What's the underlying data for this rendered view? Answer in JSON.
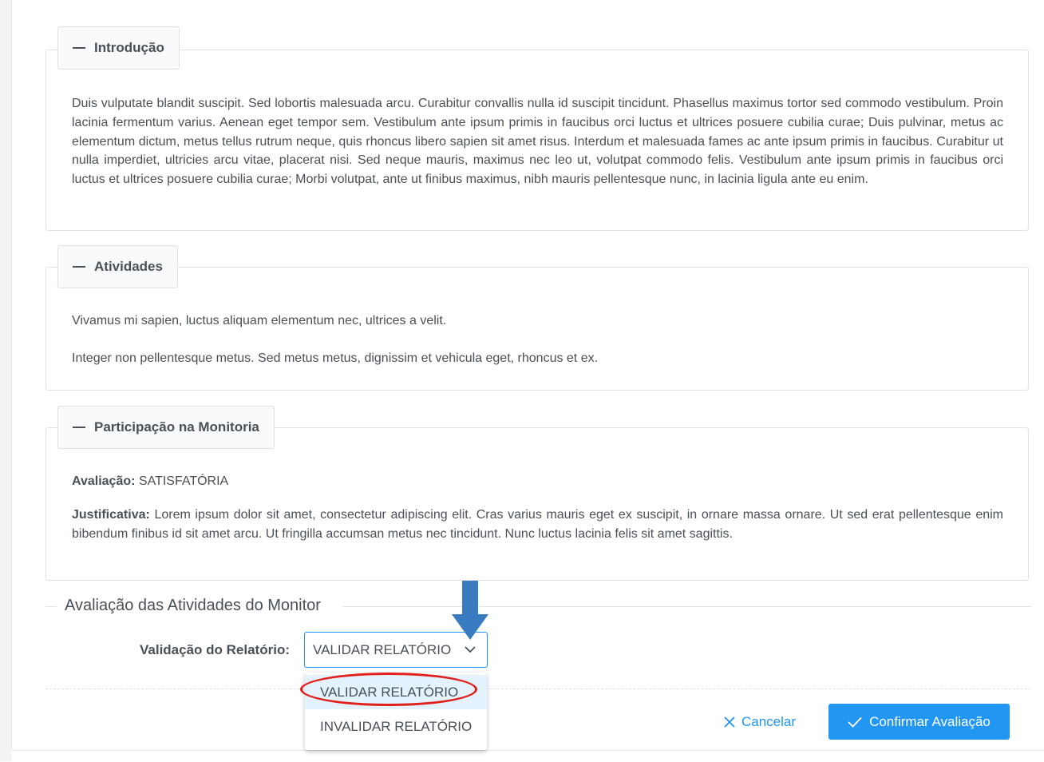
{
  "sections": {
    "introducao": {
      "legend": "Introdução",
      "text": "Duis vulputate blandit suscipit. Sed lobortis malesuada arcu. Curabitur convallis nulla id suscipit tincidunt. Phasellus maximus tortor sed commodo vestibulum. Proin lacinia fermentum varius. Aenean eget tempor sem. Vestibulum ante ipsum primis in faucibus orci luctus et ultrices posuere cubilia curae; Duis pulvinar, metus ac elementum dictum, metus tellus rutrum neque, quis rhoncus libero sapien sit amet risus. Interdum et malesuada fames ac ante ipsum primis in faucibus. Curabitur ut nulla imperdiet, ultricies arcu vitae, placerat nisi. Sed neque mauris, maximus nec leo ut, volutpat commodo felis. Vestibulum ante ipsum primis in faucibus orci luctus et ultrices posuere cubilia curae; Morbi volutpat, ante ut finibus maximus, nibh mauris pellentesque nunc, in lacinia ligula ante eu enim."
    },
    "atividades": {
      "legend": "Atividades",
      "paragraphs": [
        "Vivamus mi sapien, luctus aliquam elementum nec, ultrices a velit.",
        "Integer non pellentesque metus. Sed metus metus, dignissim et vehicula eget, rhoncus et ex."
      ]
    },
    "participacao": {
      "legend": "Participação na Monitoria",
      "avaliacao_label": "Avaliação:",
      "avaliacao_value": "SATISFATÓRIA",
      "justificativa_label": "Justificativa:",
      "justificativa_value": "Lorem ipsum dolor sit amet, consectetur adipiscing elit. Cras varius mauris eget ex suscipit, in ornare massa ornare. Ut sed erat pellentesque enim bibendum finibus id sit amet arcu. Ut fringilla accumsan metus nec tincidunt. Nunc luctus lacinia felis sit amet sagittis."
    }
  },
  "evaluation": {
    "title": "Avaliação das Atividades do Monitor",
    "field_label": "Validação do Relatório:",
    "selected_value": "VALIDAR RELATÓRIO",
    "options": [
      "VALIDAR RELATÓRIO",
      "INVALIDAR RELATÓRIO"
    ]
  },
  "actions": {
    "cancel_label": "Cancelar",
    "confirm_label": "Confirmar Avaliação"
  },
  "colors": {
    "primary": "#2196f3",
    "highlight_ring": "#e0201a",
    "arrow": "#3a7cc2"
  },
  "icons": {
    "collapse": "minus-icon",
    "dropdown": "chevron-down-icon",
    "cancel": "close-icon",
    "confirm": "check-icon",
    "annotation": "down-arrow-icon"
  }
}
